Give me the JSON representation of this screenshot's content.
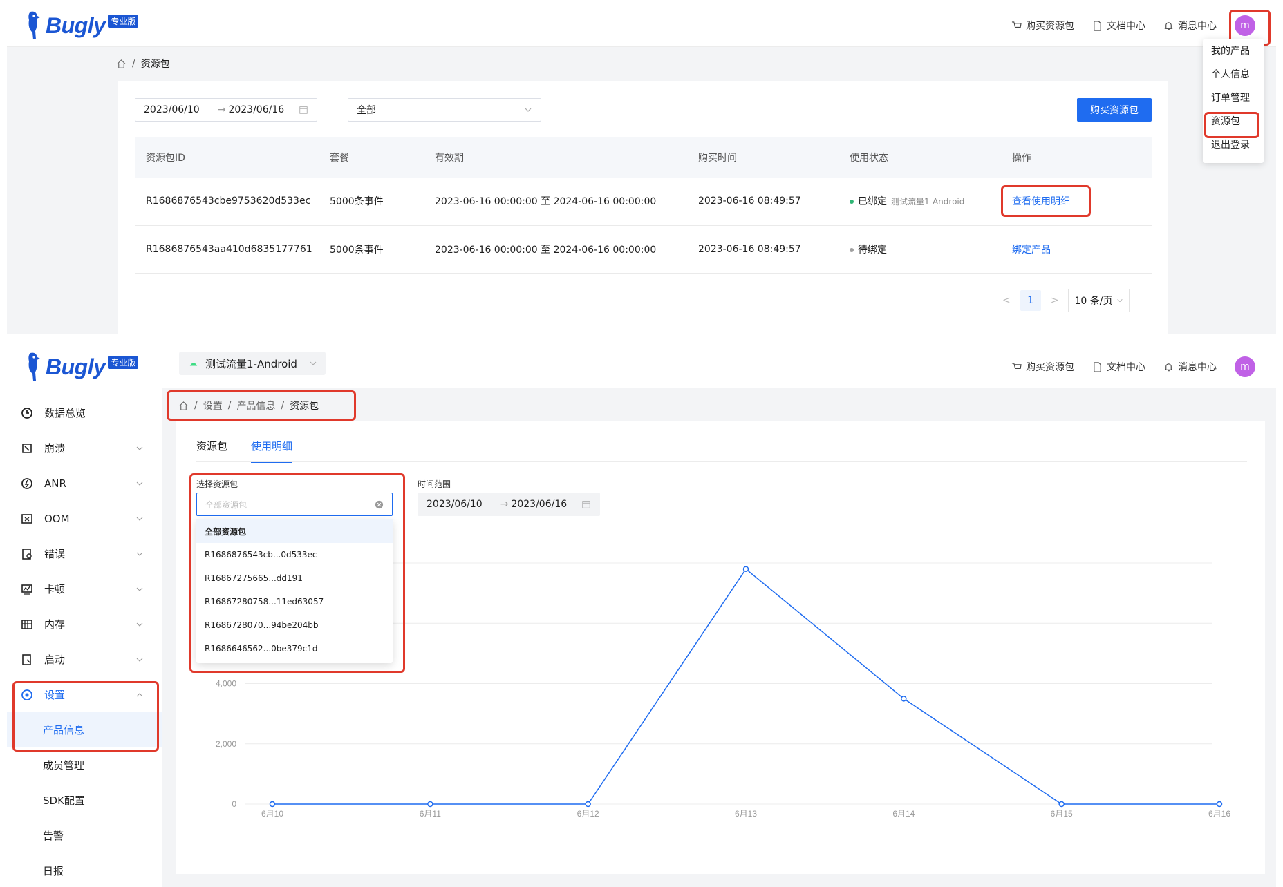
{
  "brand": {
    "name": "Bugly",
    "edition_badge": "专业版"
  },
  "topnav": {
    "buy_package": "购买资源包",
    "docs": "文档中心",
    "messages": "消息中心",
    "avatar_initial": "m"
  },
  "top_panel": {
    "breadcrumb": {
      "current": "资源包"
    },
    "filters": {
      "date_start": "2023/06/10",
      "date_end": "2023/06/16",
      "status_select": "全部"
    },
    "buy_button": "购买资源包",
    "table": {
      "headers": [
        "资源包ID",
        "套餐",
        "有效期",
        "购买时间",
        "使用状态",
        "操作"
      ],
      "rows": [
        {
          "id": "R1686876543cbe9753620d533ec",
          "plan": "5000条事件",
          "validity": "2023-06-16 00:00:00 至 2024-06-16 00:00:00",
          "purchased": "2023-06-16 08:49:57",
          "status": "已绑定",
          "status_detail": "测试流量1-Android",
          "status_color": "#2fb675",
          "action": "查看使用明细"
        },
        {
          "id": "R1686876543aa410d6835177761",
          "plan": "5000条事件",
          "validity": "2023-06-16 00:00:00 至 2024-06-16 00:00:00",
          "purchased": "2023-06-16 08:49:57",
          "status": "待绑定",
          "status_detail": "",
          "status_color": "#a0a0a0",
          "action": "绑定产品"
        }
      ]
    },
    "pagination": {
      "prev": "<",
      "current_page": "1",
      "next": ">",
      "page_size": "10 条/页"
    },
    "user_menu": [
      "我的产品",
      "个人信息",
      "订单管理",
      "资源包",
      "退出登录"
    ]
  },
  "bottom_panel": {
    "project_select": "测试流量1-Android",
    "sidebar": {
      "items": [
        {
          "label": "数据总览",
          "icon": "clock-icon"
        },
        {
          "label": "崩溃",
          "icon": "crash-icon"
        },
        {
          "label": "ANR",
          "icon": "anr-icon"
        },
        {
          "label": "OOM",
          "icon": "oom-icon"
        },
        {
          "label": "错误",
          "icon": "error-icon"
        },
        {
          "label": "卡顿",
          "icon": "lag-icon"
        },
        {
          "label": "内存",
          "icon": "memory-icon"
        },
        {
          "label": "启动",
          "icon": "startup-icon"
        },
        {
          "label": "设置",
          "icon": "settings-icon"
        }
      ],
      "sub_items": [
        "产品信息",
        "成员管理",
        "SDK配置",
        "告警",
        "日报"
      ]
    },
    "breadcrumb": {
      "settings": "设置",
      "product_info": "产品信息",
      "current": "资源包"
    },
    "tabs": [
      "资源包",
      "使用明细"
    ],
    "select_label": "选择资源包",
    "select_placeholder": "全部资源包",
    "time_label": "时间范围",
    "date_start": "2023/06/10",
    "date_end": "2023/06/16",
    "dropdown_options": [
      "全部资源包",
      "R1686876543cb...0d533ec",
      "R16867275665...dd191",
      "R16867280758...11ed63057",
      "R1686728070...94be204bb",
      "R1686646562...0be379c1d"
    ]
  },
  "chart_data": {
    "type": "line",
    "categories": [
      "6月10",
      "6月11",
      "6月12",
      "6月13",
      "6月14",
      "6月15",
      "6月16"
    ],
    "series": [
      {
        "values": [
          0,
          0,
          0,
          7800,
          3500,
          0,
          0
        ]
      }
    ],
    "y_ticks": [
      "0",
      "2,000",
      "4,000"
    ],
    "ylim": [
      0,
      8000
    ],
    "grid": true,
    "line_color": "#1f6cf0"
  }
}
